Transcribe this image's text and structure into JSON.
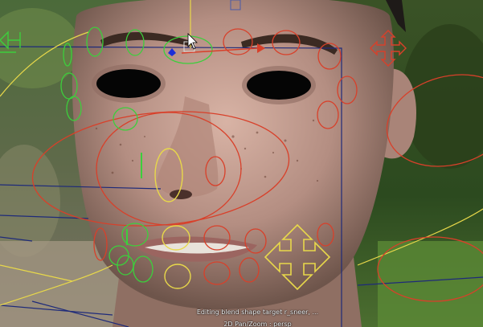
{
  "viewport": {
    "status_text": "Editing blend shape target r_sneer, ...",
    "camera_text": "2D Pan/Zoom : persp"
  },
  "rig": {
    "controls": [
      {
        "name": "brow-l-outer-control",
        "color": "green"
      },
      {
        "name": "brow-l-mid-control",
        "color": "green"
      },
      {
        "name": "brow-center-control",
        "color": "green"
      },
      {
        "name": "brow-r-control",
        "color": "red"
      },
      {
        "name": "brow-r-outer-control",
        "color": "red"
      },
      {
        "name": "cheek-l-control",
        "color": "green"
      },
      {
        "name": "cheek-r-control",
        "color": "red"
      },
      {
        "name": "nose-control",
        "color": "yellow"
      },
      {
        "name": "nostril-r-control",
        "color": "red"
      },
      {
        "name": "lip-upper-control",
        "color": "yellow"
      },
      {
        "name": "lip-lower-control",
        "color": "yellow"
      },
      {
        "name": "mouth-corner-l-control",
        "color": "green"
      },
      {
        "name": "mouth-corner-r-control",
        "color": "red"
      },
      {
        "name": "jaw-move-control",
        "color": "yellow"
      },
      {
        "name": "head-move-control",
        "color": "green"
      },
      {
        "name": "eye-move-control",
        "color": "red"
      }
    ]
  }
}
